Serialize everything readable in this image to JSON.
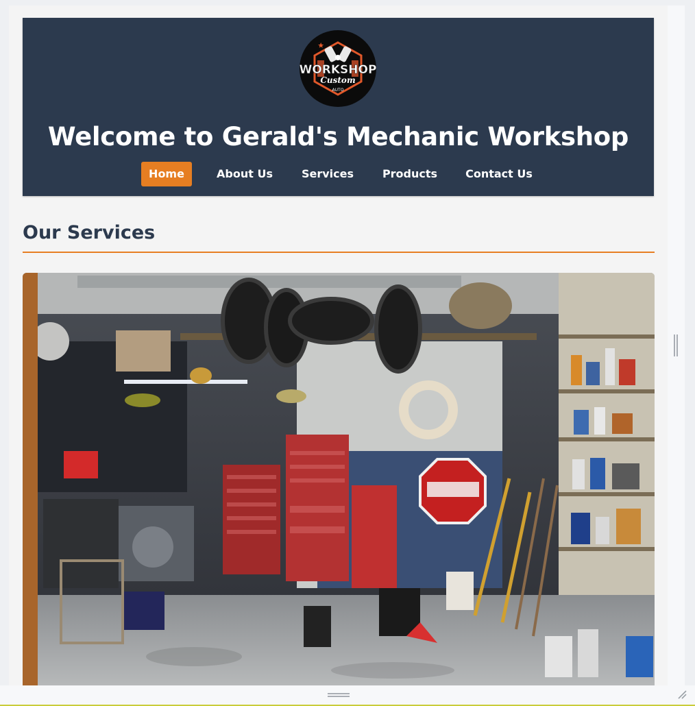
{
  "header": {
    "title": "Welcome to Gerald's Mechanic Workshop",
    "logo": {
      "line1": "WORKSHOP",
      "line2": "Custom",
      "line3": "AUTO",
      "icon": "crossed-pistons-logo"
    }
  },
  "nav": {
    "items": [
      {
        "label": "Home",
        "active": true
      },
      {
        "label": "About Us",
        "active": false
      },
      {
        "label": "Services",
        "active": false
      },
      {
        "label": "Products",
        "active": false
      },
      {
        "label": "Contact Us",
        "active": false
      }
    ]
  },
  "main": {
    "section_title": "Our Services",
    "photo": "garage-workshop-photo"
  },
  "colors": {
    "header_bg": "#2c3a4e",
    "accent": "#e67e22",
    "page_bg": "#f4f4f4"
  },
  "icons": {
    "scroll_grip": "scroll-grip-icon",
    "bottom_grip": "resize-grip-icon",
    "corner": "resize-corner-icon"
  }
}
